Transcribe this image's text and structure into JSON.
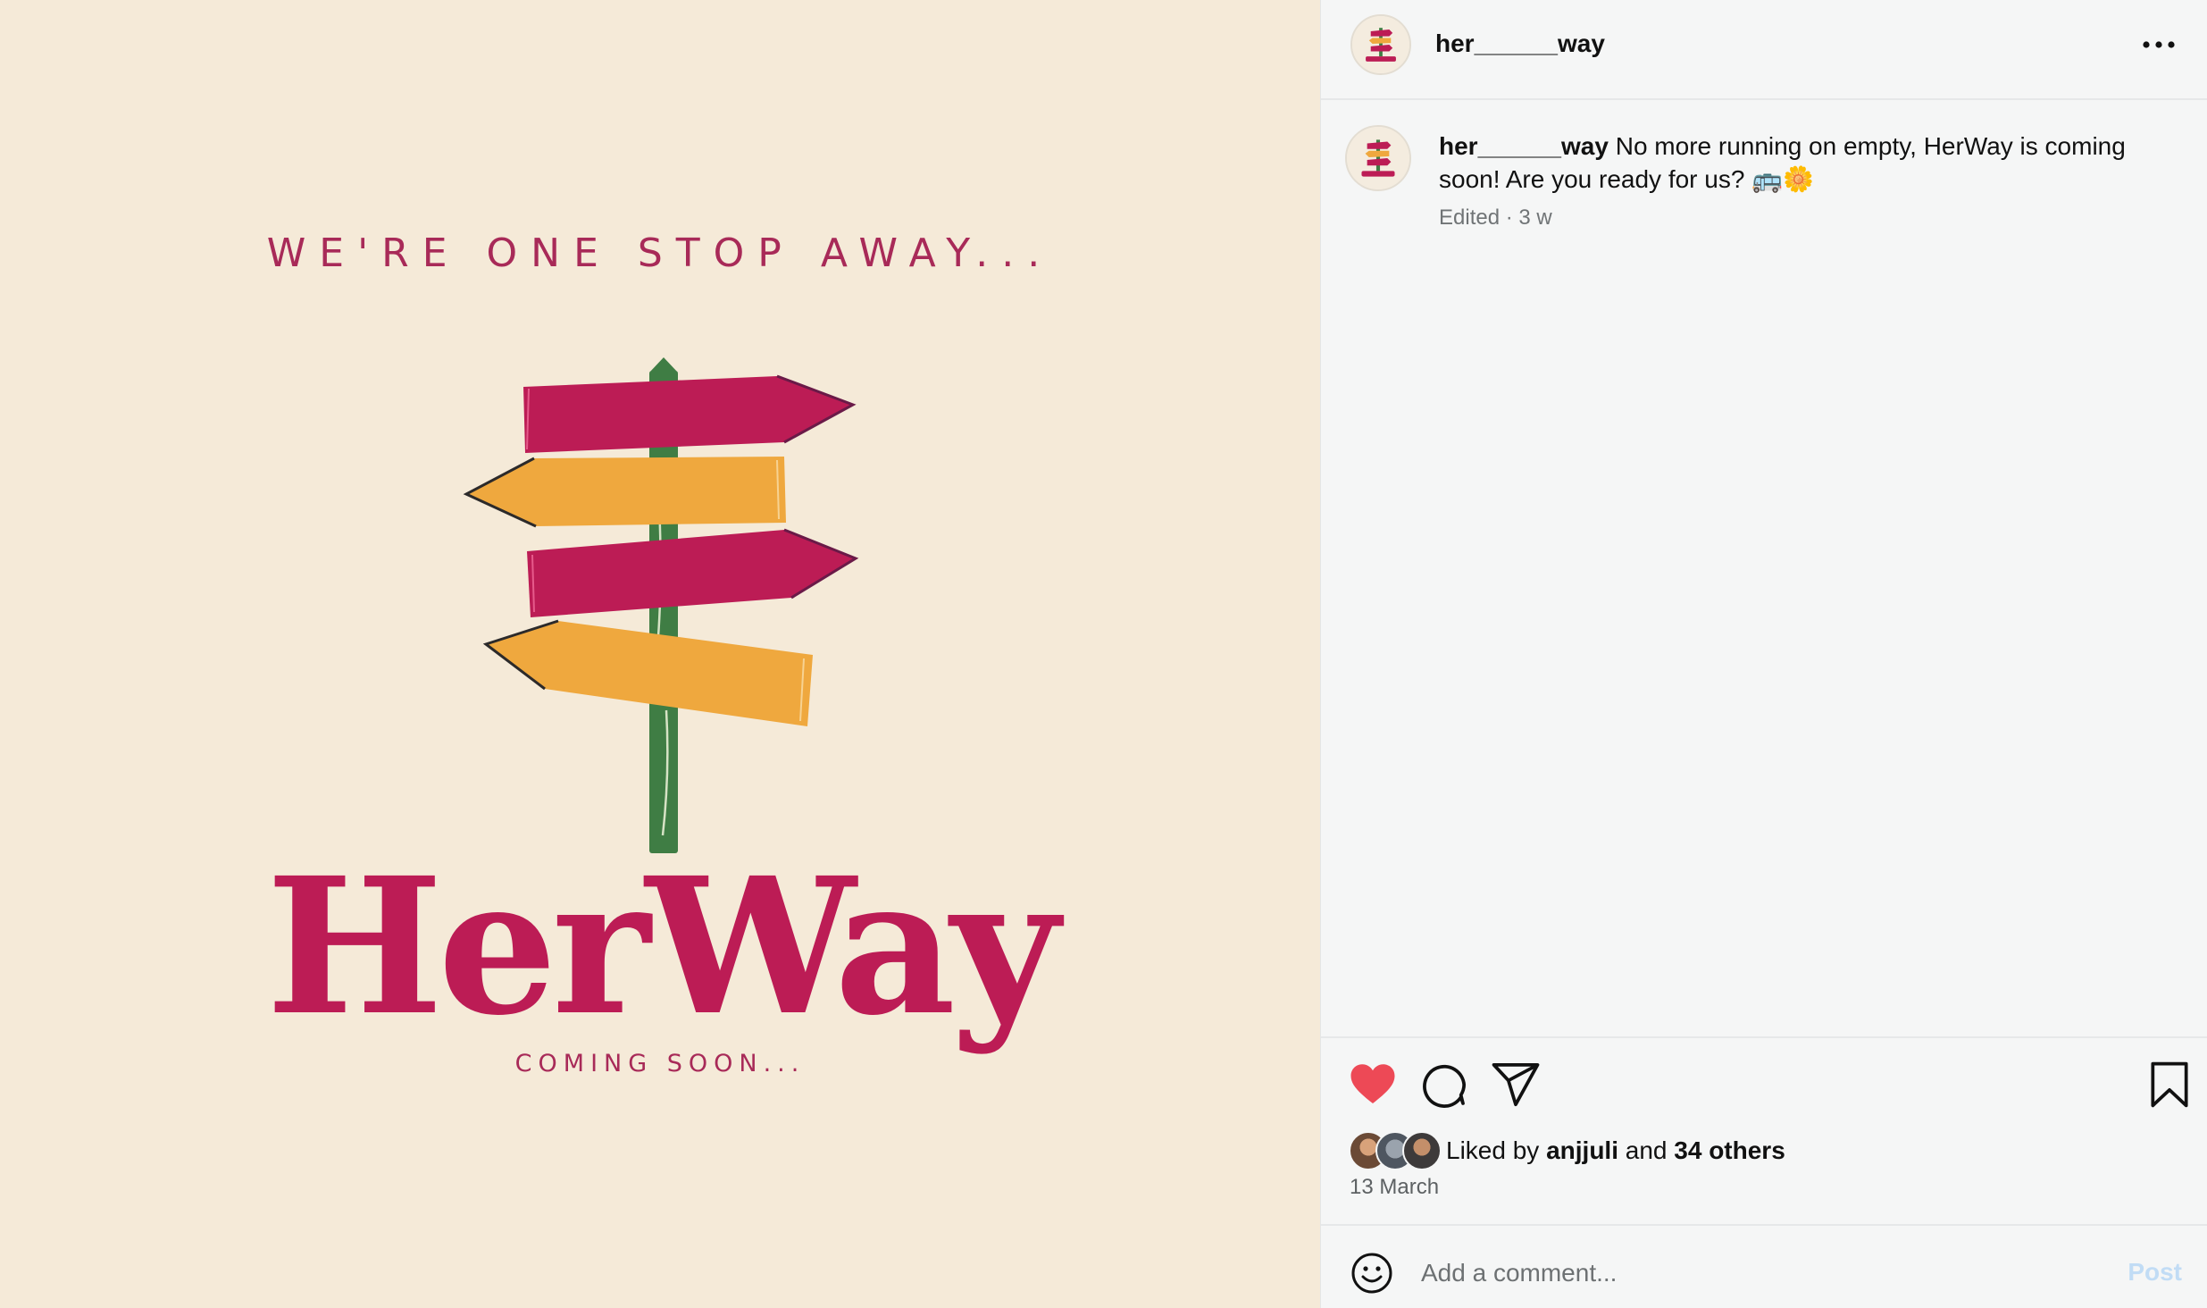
{
  "image": {
    "tagline": "WE'RE ONE STOP AWAY...",
    "brand": "HerWay",
    "subtitle": "COMING SOON...",
    "colors": {
      "background": "#f5ead8",
      "magenta": "#bc1c55",
      "orange": "#efa83e",
      "post": "#3f7d44"
    }
  },
  "header": {
    "username": "her______way",
    "more_icon": "more-horizontal-icon"
  },
  "caption": {
    "username": "her______way",
    "text": "No more running on empty, HerWay is coming soon! Are you ready for us? 🚌🌼",
    "meta": "Edited · 3 w"
  },
  "actions": {
    "like_icon": "heart-filled-icon",
    "comment_icon": "comment-icon",
    "share_icon": "paper-plane-icon",
    "save_icon": "bookmark-icon",
    "like_color": "#ed4956"
  },
  "likes": {
    "prefix": "Liked by",
    "first_user": "anjjuli",
    "connector": "and",
    "others": "34 others",
    "date": "13 March"
  },
  "comment": {
    "placeholder": "Add a comment...",
    "post_label": "Post",
    "emoji_icon": "smiley-icon"
  }
}
